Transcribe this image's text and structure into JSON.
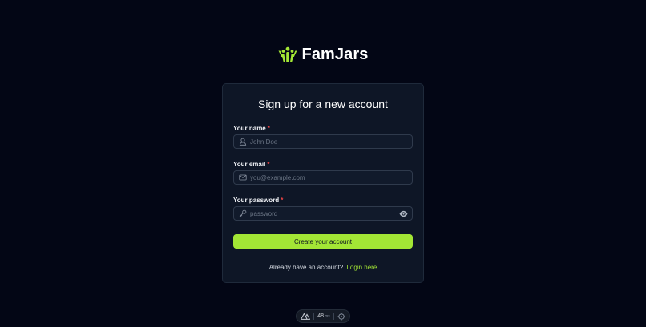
{
  "brand": {
    "name": "FamJars",
    "icon": "people-logo-icon",
    "accent_color": "#a3e635"
  },
  "signup": {
    "title": "Sign up for a new account",
    "required_marker": "*",
    "fields": {
      "name": {
        "label": "Your name",
        "placeholder": "John Doe",
        "icon": "user-icon"
      },
      "email": {
        "label": "Your email",
        "placeholder": "you@example.com",
        "icon": "mail-icon"
      },
      "password": {
        "label": "Your password",
        "placeholder": "password",
        "icon": "key-icon",
        "toggle_icon": "eye-icon"
      }
    },
    "submit_label": "Create your account",
    "footer_text": "Already have an account?",
    "login_link": "Login here"
  },
  "devbar": {
    "logo_icon": "nuxt-logo-icon",
    "value": "48",
    "unit": "ms",
    "inspect_icon": "target-icon"
  }
}
